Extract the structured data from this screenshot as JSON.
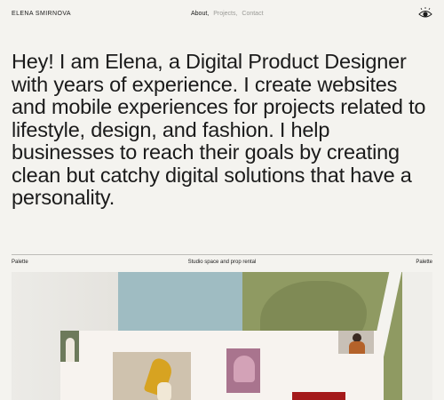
{
  "header": {
    "brand": "ELENA SMIRNOVA",
    "nav": [
      {
        "label": "About,",
        "state": "active"
      },
      {
        "label": "Projects,",
        "state": "muted"
      },
      {
        "label": "Contact",
        "state": "muted"
      }
    ],
    "menu_icon": "eye-icon"
  },
  "hero": {
    "text": "Hey! I am Elena, a Digital Product Designer with years of experience. I create websites and mobile experiences for projects related to lifestyle, design, and fashion. I help businesses to reach their goals by creating clean but catchy digital solutions that have a personality."
  },
  "project": {
    "name_left": "Palette",
    "subtitle": "Studio space and prop rental",
    "name_right": "Palette"
  },
  "colors": {
    "background": "#f4f3ef",
    "text": "#1b1b1b",
    "muted": "#9a9a96"
  }
}
